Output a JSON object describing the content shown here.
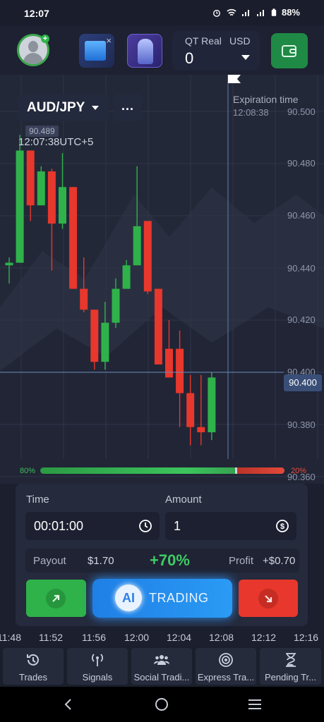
{
  "status_bar": {
    "time": "12:07",
    "battery": "88%"
  },
  "header": {
    "account_type": "QT Real",
    "currency": "USD",
    "balance": "0"
  },
  "chart": {
    "pair": "AUD/JPY",
    "more_label": "...",
    "last_tag": "90.489",
    "clock": "12:07:38UTC+5",
    "expiration_title": "Expiration time",
    "expiration_time": "12:08:38",
    "current_price": "90.400",
    "y_labels": [
      "90.500",
      "90.480",
      "90.460",
      "90.440",
      "90.420",
      "90.400",
      "90.380",
      "90.360"
    ]
  },
  "chart_data": {
    "type": "candlestick",
    "ylim": [
      90.355,
      90.505
    ],
    "current": 90.4,
    "candles": [
      {
        "o": 90.441,
        "c": 90.442,
        "h": 90.444,
        "l": 90.434
      },
      {
        "o": 90.442,
        "c": 90.485,
        "h": 90.491,
        "l": 90.442
      },
      {
        "o": 90.485,
        "c": 90.464,
        "h": 90.485,
        "l": 90.458
      },
      {
        "o": 90.464,
        "c": 90.477,
        "h": 90.479,
        "l": 90.464
      },
      {
        "o": 90.477,
        "c": 90.457,
        "h": 90.478,
        "l": 90.439
      },
      {
        "o": 90.457,
        "c": 90.471,
        "h": 90.484,
        "l": 90.455
      },
      {
        "o": 90.471,
        "c": 90.432,
        "h": 90.471,
        "l": 90.432
      },
      {
        "o": 90.432,
        "c": 90.424,
        "h": 90.444,
        "l": 90.423
      },
      {
        "o": 90.424,
        "c": 90.404,
        "h": 90.424,
        "l": 90.401
      },
      {
        "o": 90.404,
        "c": 90.419,
        "h": 90.427,
        "l": 90.401
      },
      {
        "o": 90.419,
        "c": 90.432,
        "h": 90.436,
        "l": 90.417
      },
      {
        "o": 90.432,
        "c": 90.441,
        "h": 90.443,
        "l": 90.432
      },
      {
        "o": 90.441,
        "c": 90.456,
        "h": 90.479,
        "l": 90.441
      },
      {
        "o": 90.458,
        "c": 90.431,
        "h": 90.458,
        "l": 90.43
      },
      {
        "o": 90.432,
        "c": 90.403,
        "h": 90.432,
        "l": 90.403
      },
      {
        "o": 90.409,
        "c": 90.398,
        "h": 90.42,
        "l": 90.398
      },
      {
        "o": 90.409,
        "c": 90.392,
        "h": 90.416,
        "l": 90.379
      },
      {
        "o": 90.392,
        "c": 90.379,
        "h": 90.399,
        "l": 90.372
      },
      {
        "o": 90.379,
        "c": 90.377,
        "h": 90.399,
        "l": 90.372
      },
      {
        "o": 90.377,
        "c": 90.398,
        "h": 90.4,
        "l": 90.374
      }
    ]
  },
  "sentiment": {
    "up": "80%",
    "down": "20%",
    "up_fraction": 0.8
  },
  "trade": {
    "time_label": "Time",
    "time_value": "00:01:00",
    "amount_label": "Amount",
    "amount_value": "1",
    "payout_label": "Payout",
    "payout_value": "$1.70",
    "percent": "+70%",
    "profit_label": "Profit",
    "profit_value": "+$0.70",
    "ai_badge": "AI",
    "ai_label": "TRADING"
  },
  "time_axis": [
    "11:48",
    "11:52",
    "11:56",
    "12:00",
    "12:04",
    "12:08",
    "12:12",
    "12:16"
  ],
  "tabs": [
    {
      "label": "Trades",
      "icon": "history-icon"
    },
    {
      "label": "Signals",
      "icon": "signal-antenna-icon"
    },
    {
      "label": "Social Tradi...",
      "icon": "people-icon"
    },
    {
      "label": "Express Tra...",
      "icon": "target-icon"
    },
    {
      "label": "Pending Tr...",
      "icon": "hourglass-icon"
    }
  ],
  "colors": {
    "up": "#2fb24a",
    "down": "#e8372c",
    "accent": "#2a9bf5",
    "background": "#1b1f2e"
  }
}
